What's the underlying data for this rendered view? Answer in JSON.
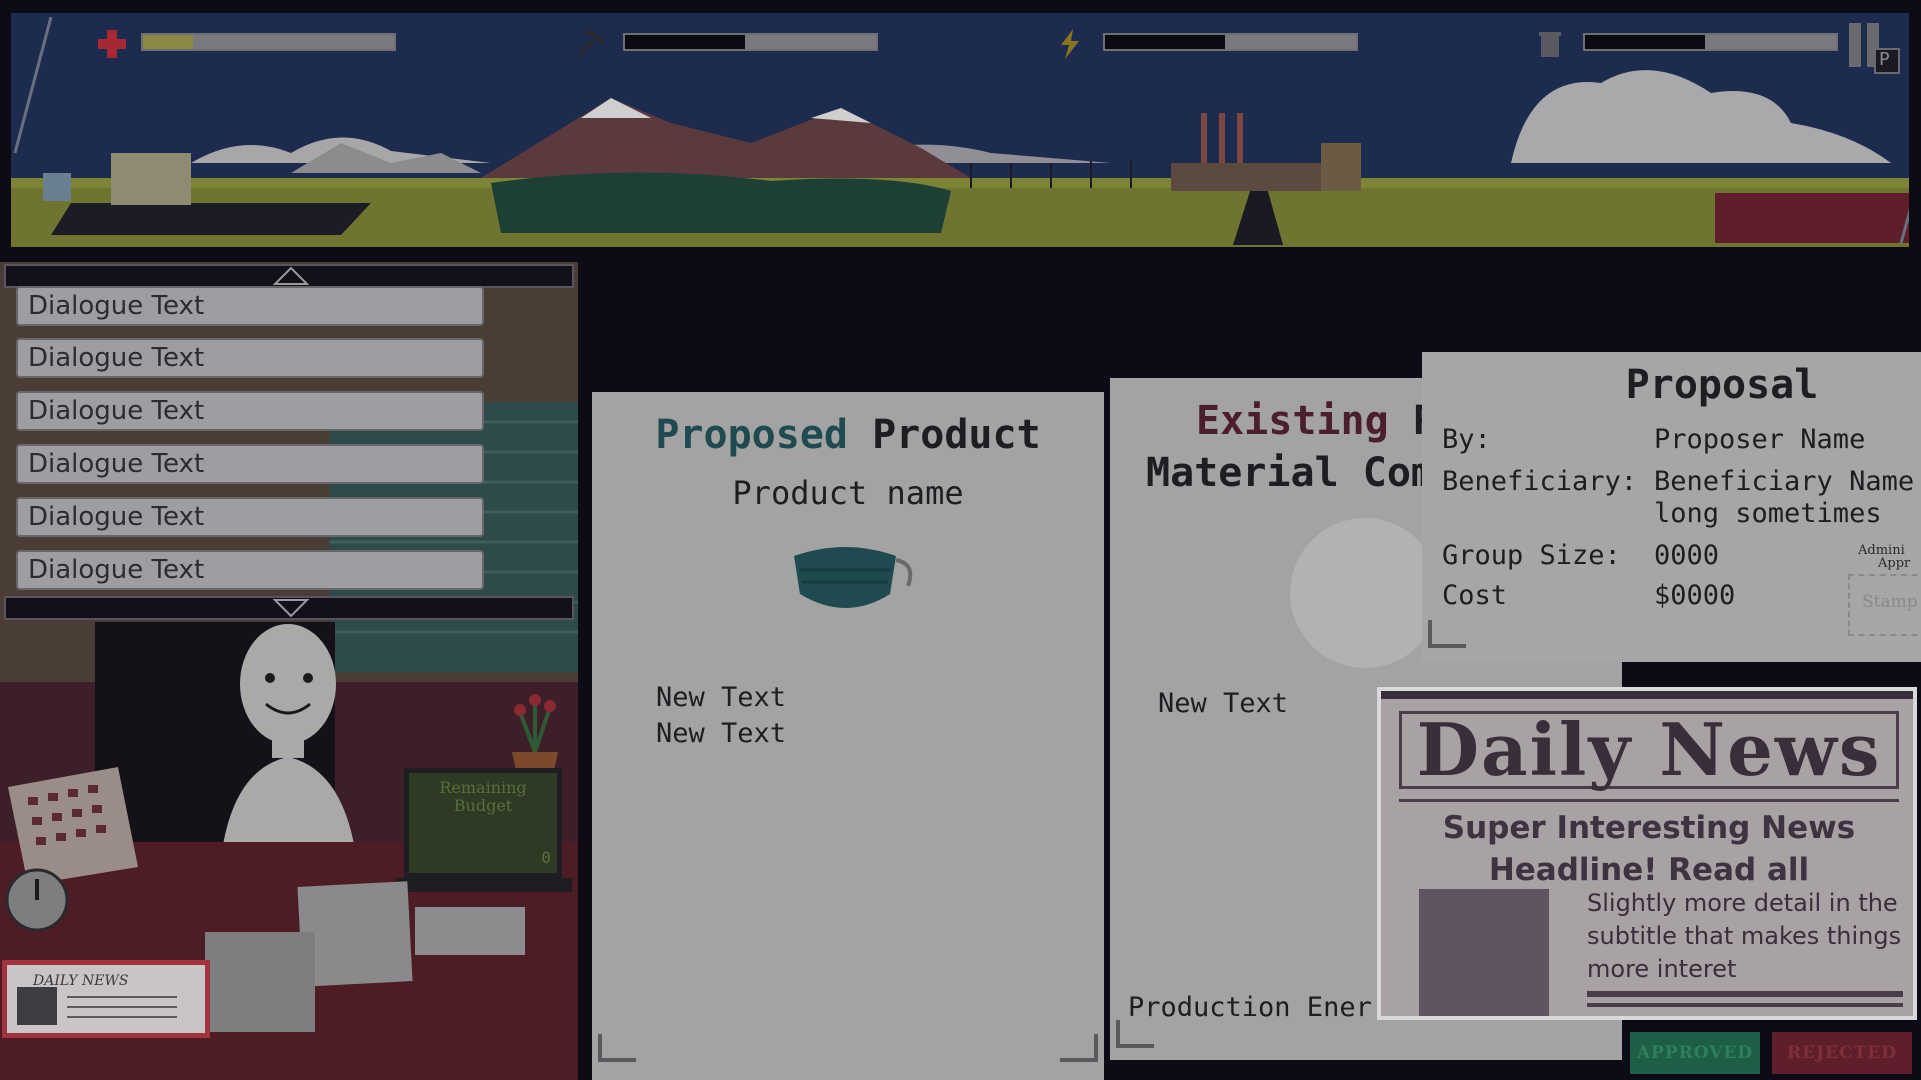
{
  "hud": {
    "health_level": 0.2,
    "resources_level": 0.48,
    "energy_level": 0.48,
    "waste_level": 0.48,
    "pause_label": "P"
  },
  "dialogue": {
    "options": [
      "Dialogue Text",
      "Dialogue Text",
      "Dialogue Text",
      "Dialogue Text",
      "Dialogue Text",
      "Dialogue Text"
    ]
  },
  "desk": {
    "laptop_text": "Remaining Budget",
    "laptop_value": "0",
    "newspaper_thumb": "DAILY NEWS"
  },
  "proposed": {
    "title_word1": "Proposed",
    "title_word2": "Product",
    "product_name": "Product name",
    "line1": "New Text",
    "line2": "New Text",
    "colors": {
      "accent": "#1f4a50",
      "text": "#1e1e22"
    }
  },
  "existing": {
    "title_word1": "Existing",
    "title_word2": "Pr",
    "subtitle": "Material Com",
    "line1": "New Text",
    "footer": "Production Ener",
    "colors": {
      "accent": "#4a1e2c"
    }
  },
  "proposal": {
    "title": "Proposal",
    "by_label": "By:",
    "by_value": "Proposer Name",
    "beneficiary_label": "Beneficiary:",
    "beneficiary_value": "Beneficiary Name",
    "beneficiary_value2": "long sometimes",
    "group_label": "Group Size:",
    "group_value": "0000",
    "cost_label": "Cost",
    "cost_value": "$0000",
    "admin_label": "Admini",
    "admin_label2": "Appr",
    "stamp_label": "Stamp"
  },
  "news": {
    "masthead": "Daily News",
    "headline1": "Super Interesting News",
    "headline2": "Headline! Read all",
    "detail1": "Slightly more detail in the",
    "detail2": "subtitle that makes things",
    "detail3": "more interet"
  },
  "stamps": {
    "approved": "APPROVED",
    "rejected": "REJECTED",
    "approved_color": "#1f5e46",
    "rejected_color": "#5e1f2a"
  }
}
